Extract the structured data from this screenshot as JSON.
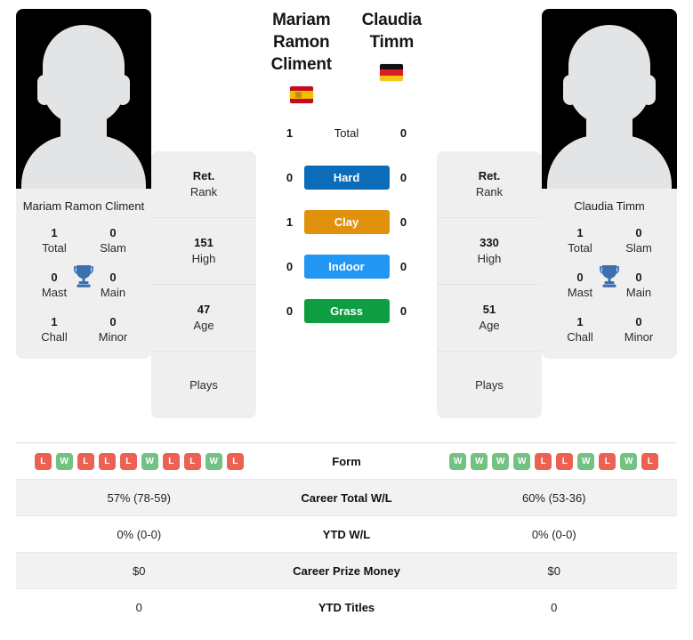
{
  "players": [
    {
      "name": "Mariam Ramon Climent",
      "name_line1": "Mariam Ramon",
      "name_line2": "Climent",
      "country": "Spain",
      "flag_icon": "flag-spain-icon",
      "titles": {
        "total": "1",
        "total_label": "Total",
        "slam": "0",
        "slam_label": "Slam",
        "mast": "0",
        "mast_label": "Mast",
        "main": "0",
        "main_label": "Main",
        "chall": "1",
        "chall_label": "Chall",
        "minor": "0",
        "minor_label": "Minor"
      },
      "stack": {
        "rank_value": "Ret.",
        "rank_label": "Rank",
        "high_value": "151",
        "high_label": "High",
        "age_value": "47",
        "age_label": "Age",
        "plays_value": "",
        "plays_label": "Plays"
      },
      "surface_wins": {
        "total": "1",
        "hard": "0",
        "clay": "1",
        "indoor": "0",
        "grass": "0"
      },
      "form": [
        "L",
        "W",
        "L",
        "L",
        "L",
        "W",
        "L",
        "L",
        "W",
        "L"
      ],
      "career_total_wl": "57% (78-59)",
      "ytd_wl": "0% (0-0)",
      "career_prize_money": "$0",
      "ytd_titles": "0"
    },
    {
      "name": "Claudia Timm",
      "name_line1": "Claudia",
      "name_line2": "Timm",
      "country": "Germany",
      "flag_icon": "flag-germany-icon",
      "titles": {
        "total": "1",
        "total_label": "Total",
        "slam": "0",
        "slam_label": "Slam",
        "mast": "0",
        "mast_label": "Mast",
        "main": "0",
        "main_label": "Main",
        "chall": "1",
        "chall_label": "Chall",
        "minor": "0",
        "minor_label": "Minor"
      },
      "stack": {
        "rank_value": "Ret.",
        "rank_label": "Rank",
        "high_value": "330",
        "high_label": "High",
        "age_value": "51",
        "age_label": "Age",
        "plays_value": "",
        "plays_label": "Plays"
      },
      "surface_wins": {
        "total": "0",
        "hard": "0",
        "clay": "0",
        "indoor": "0",
        "grass": "0"
      },
      "form": [
        "W",
        "W",
        "W",
        "W",
        "L",
        "L",
        "W",
        "L",
        "W",
        "L"
      ],
      "career_total_wl": "60% (53-36)",
      "ytd_wl": "0% (0-0)",
      "career_prize_money": "$0",
      "ytd_titles": "0"
    }
  ],
  "surfaces": [
    {
      "key": "total",
      "label": "Total",
      "color": "",
      "plain": true
    },
    {
      "key": "hard",
      "label": "Hard",
      "color": "#0b6cba",
      "plain": false
    },
    {
      "key": "clay",
      "label": "Clay",
      "color": "#e0920c",
      "plain": false
    },
    {
      "key": "grass_placeholder",
      "label": "Indoor",
      "color": "#2196f3",
      "plain": false
    },
    {
      "key": "grass",
      "label": "Grass",
      "color": "#0f9d42",
      "plain": false
    }
  ],
  "surface_labels": {
    "total": "Total",
    "hard": "Hard",
    "clay": "Clay",
    "indoor": "Indoor",
    "grass": "Grass"
  },
  "table_rows": [
    {
      "label": "Form",
      "type": "form"
    },
    {
      "label": "Career Total W/L",
      "type": "text",
      "key": "career_total_wl"
    },
    {
      "label": "YTD W/L",
      "type": "text",
      "key": "ytd_wl"
    },
    {
      "label": "Career Prize Money",
      "type": "text",
      "key": "career_prize_money"
    },
    {
      "label": "YTD Titles",
      "type": "text",
      "key": "ytd_titles"
    }
  ],
  "colors": {
    "hard": "#0b6cba",
    "clay": "#e0920c",
    "indoor": "#2196f3",
    "grass": "#0f9d42",
    "win_badge": "#74c282",
    "loss_badge": "#eb6252",
    "card_bg": "#efefef",
    "trophy": "#3a6fb0"
  }
}
